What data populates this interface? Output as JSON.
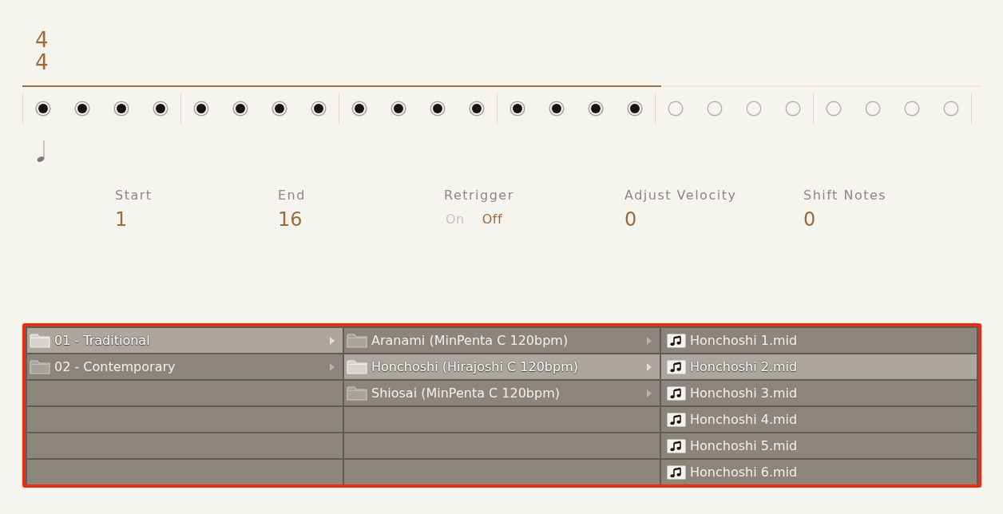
{
  "time_signature": {
    "numerator": "4",
    "denominator": "4"
  },
  "length_bar": {
    "level": 0.6667
  },
  "steps": [
    {
      "active": true
    },
    {
      "active": true
    },
    {
      "active": true
    },
    {
      "active": true
    },
    {
      "active": true
    },
    {
      "active": true
    },
    {
      "active": true
    },
    {
      "active": true
    },
    {
      "active": true
    },
    {
      "active": true
    },
    {
      "active": true
    },
    {
      "active": true
    },
    {
      "active": true
    },
    {
      "active": true
    },
    {
      "active": true
    },
    {
      "active": true
    },
    {
      "active": false
    },
    {
      "active": false
    },
    {
      "active": false
    },
    {
      "active": false
    },
    {
      "active": false
    },
    {
      "active": false
    },
    {
      "active": false
    },
    {
      "active": false
    }
  ],
  "parameters": [
    {
      "kind": "value",
      "label": "Start",
      "value": "1"
    },
    {
      "kind": "value",
      "label": "End",
      "value": "16"
    },
    {
      "kind": "toggle",
      "label": "Retrigger",
      "options": [
        {
          "label": "On",
          "selected": false
        },
        {
          "label": "Off",
          "selected": true
        }
      ]
    },
    {
      "kind": "value",
      "label": "Adjust Velocity",
      "value": "0"
    },
    {
      "kind": "value",
      "label": "Shift Notes",
      "value": "0"
    }
  ],
  "browser": {
    "highlighted": true,
    "columns": [
      {
        "items": [
          {
            "kind": "folder",
            "label": "01 - Traditional",
            "selected": true
          },
          {
            "kind": "folder",
            "label": "02 - Contemporary",
            "selected": false
          }
        ]
      },
      {
        "items": [
          {
            "kind": "folder",
            "label": "Aranami (MinPenta C 120bpm)",
            "selected": false
          },
          {
            "kind": "folder",
            "label": "Honchoshi (Hirajoshi C 120bpm)",
            "selected": true
          },
          {
            "kind": "folder",
            "label": "Shiosai (MinPenta C 120bpm)",
            "selected": false
          }
        ]
      },
      {
        "items": [
          {
            "kind": "midi",
            "label": "Honchoshi 1.mid",
            "selected": false
          },
          {
            "kind": "midi",
            "label": "Honchoshi 2.mid",
            "selected": true
          },
          {
            "kind": "midi",
            "label": "Honchoshi 3.mid",
            "selected": false
          },
          {
            "kind": "midi",
            "label": "Honchoshi 4.mid",
            "selected": false
          },
          {
            "kind": "midi",
            "label": "Honchoshi 5.mid",
            "selected": false
          },
          {
            "kind": "midi",
            "label": "Honchoshi 6.mid",
            "selected": false
          }
        ]
      }
    ]
  }
}
